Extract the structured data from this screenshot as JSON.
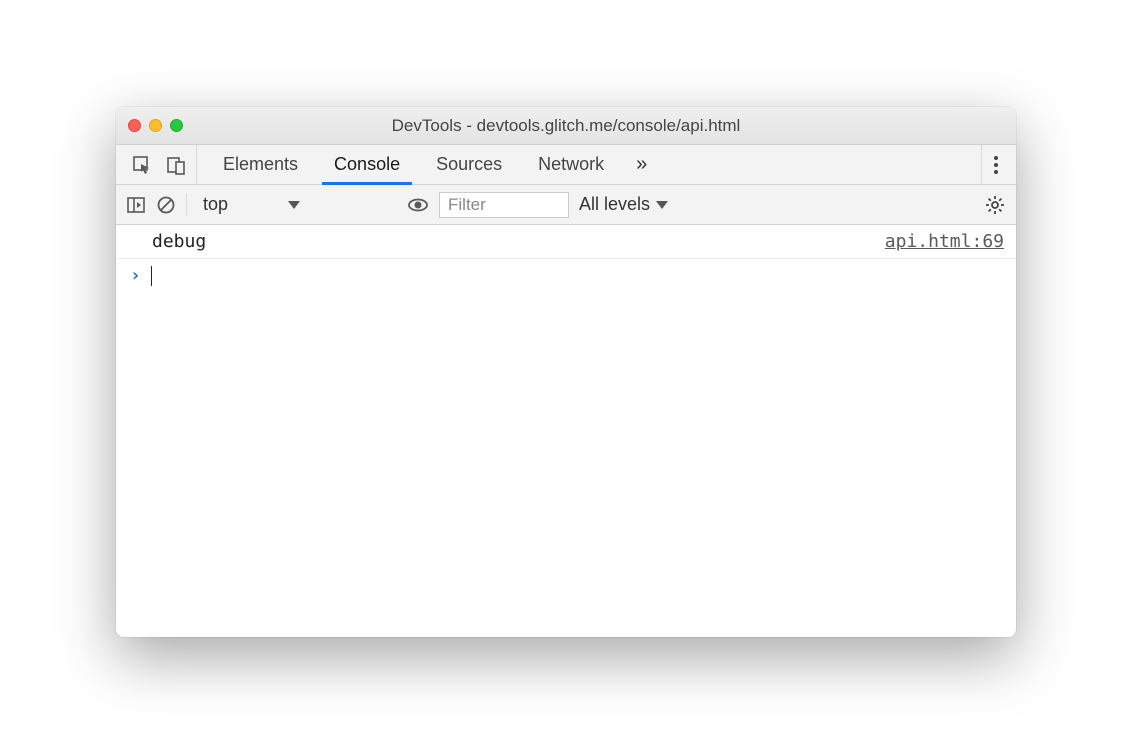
{
  "window": {
    "title": "DevTools - devtools.glitch.me/console/api.html"
  },
  "tabs": {
    "items": [
      "Elements",
      "Console",
      "Sources",
      "Network"
    ],
    "active_index": 1,
    "more_glyph": "»"
  },
  "toolbar": {
    "context": "top",
    "filter_placeholder": "Filter",
    "levels_label": "All levels"
  },
  "log": {
    "entries": [
      {
        "message": "debug",
        "source": "api.html:69"
      }
    ],
    "prompt_glyph": "›"
  }
}
